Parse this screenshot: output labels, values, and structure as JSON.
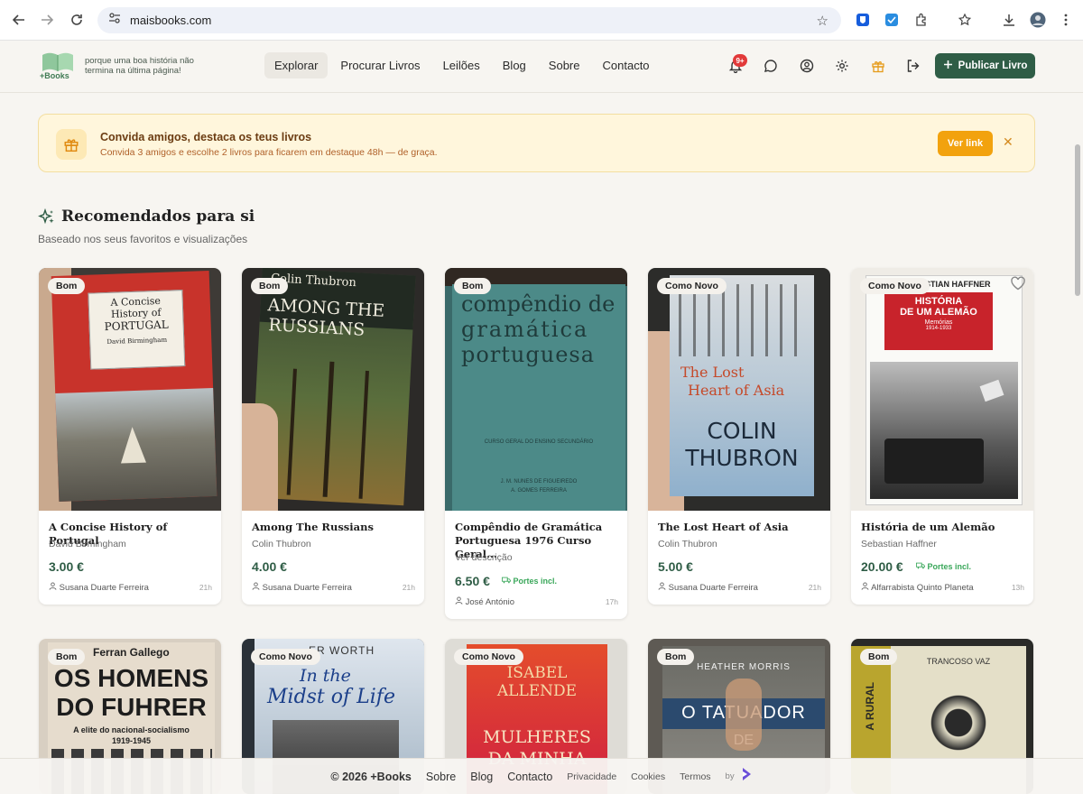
{
  "browser": {
    "url": "maisbooks.com"
  },
  "header": {
    "logo_text": "+Books",
    "tagline": "porque uma boa história não termina na última página!",
    "nav": [
      {
        "label": "Explorar",
        "active": true
      },
      {
        "label": "Procurar Livros",
        "active": false
      },
      {
        "label": "Leilões",
        "active": false
      },
      {
        "label": "Blog",
        "active": false
      },
      {
        "label": "Sobre",
        "active": false
      },
      {
        "label": "Contacto",
        "active": false
      }
    ],
    "notifications_badge": "9+",
    "publish_label": "Publicar Livro"
  },
  "invite": {
    "title": "Convida amigos, destaca os teus livros",
    "subtitle": "Convida 3 amigos e escolhe 2 livros para ficarem em destaque 48h — de graça.",
    "button": "Ver link"
  },
  "recommended": {
    "title": "Recomendados para si",
    "subtitle": "Baseado nos seus favoritos e visualizações"
  },
  "cards": [
    {
      "condition": "Bom",
      "title": "A Concise History of Portugal",
      "author": "David Birmingham",
      "price": "3.00 €",
      "portes": "",
      "seller": "Susana Duarte Ferreira",
      "time": "21h"
    },
    {
      "condition": "Bom",
      "title": "Among The Russians",
      "author": "Colin Thubron",
      "price": "4.00 €",
      "portes": "",
      "seller": "Susana Duarte Ferreira",
      "time": "21h"
    },
    {
      "condition": "Bom",
      "title": "Compêndio de Gramática Portuguesa 1976 Curso Geral...",
      "author": "Ver descrição",
      "price": "6.50 €",
      "portes": "Portes incl.",
      "seller": "José António",
      "time": "17h"
    },
    {
      "condition": "Como Novo",
      "title": "The Lost Heart of Asia",
      "author": "Colin Thubron",
      "price": "5.00 €",
      "portes": "",
      "seller": "Susana Duarte Ferreira",
      "time": "21h"
    },
    {
      "condition": "Como Novo",
      "title": "História de um Alemão",
      "author": "Sebastian Haffner",
      "price": "20.00 €",
      "portes": "Portes incl.",
      "seller": "Alfarrabista Quinto Planeta",
      "time": "13h"
    }
  ],
  "covers": [
    {
      "line1": "A Concise",
      "line2": "History of",
      "line3": "PORTUGAL",
      "line4": "David Birmingham"
    },
    {
      "line1": "Colin Thubron",
      "line2": "AMONG THE",
      "line3": "RUSSIANS"
    },
    {
      "line1": "compêndio de",
      "line2": "gramática",
      "line3": "portuguesa",
      "line4": "CURSO GERAL DO ENSINO SECUNDÁRIO",
      "line5": "J. M. NUNES DE FIGUEIREDO",
      "line6": "A. GOMES FERREIRA"
    },
    {
      "line1": "The Lost",
      "line2": "Heart of Asia",
      "line3": "COLIN",
      "line4": "THUBRON"
    },
    {
      "line1": "SEBASTIAN HAFFNER",
      "line2": "HISTÓRIA",
      "line3": "DE UM ALEMÃO",
      "line4": "Memórias",
      "line5": "1914-1933"
    }
  ],
  "cards_row2": [
    {
      "condition": "Bom",
      "cover_title1": "Ferran Gallego",
      "cover_title2": "OS HOMENS",
      "cover_title3": "DO FUHRER",
      "cover_sub": "A elite do nacional-socialismo",
      "cover_years": "1919-1945"
    },
    {
      "condition": "Como Novo",
      "cover_title1": "ER WORTH",
      "cover_title2": "In the",
      "cover_title3": "Midst of Life"
    },
    {
      "condition": "Como Novo",
      "cover_title1": "ISABEL",
      "cover_title2": "ALLENDE",
      "cover_title3": "MULHERES",
      "cover_title4": "DA MINHA"
    },
    {
      "condition": "Bom",
      "cover_title1": "HEATHER MORRIS",
      "cover_title2": "O TATUADOR",
      "cover_title3": "DE"
    },
    {
      "condition": "Bom",
      "cover_title1": "TRANCOSO VAZ",
      "cover_title2": "A RURAL"
    }
  ],
  "footer": {
    "copyright": "© 2026 +Books",
    "links_big": [
      "Sobre",
      "Blog",
      "Contacto"
    ],
    "links_small": [
      "Privacidade",
      "Cookies",
      "Termos"
    ],
    "by": "by"
  }
}
